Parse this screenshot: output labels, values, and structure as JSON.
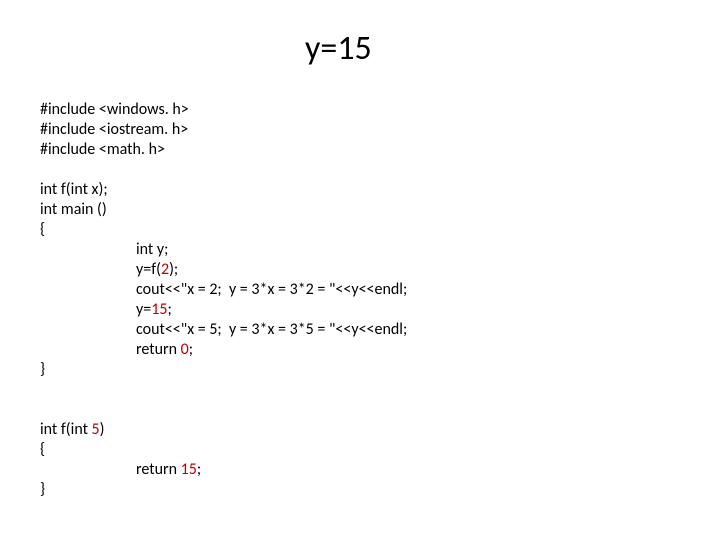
{
  "title": "y=15",
  "code": {
    "inc1": "#include <windows. h>",
    "inc2": "#include <iostream. h>",
    "inc3": "#include <math. h>",
    "proto": "int f(int x);",
    "main_sig": "int main ()",
    "open_brace": "{",
    "body_int_y": "int y;",
    "body_y_f": "y=f(",
    "body_y_f_arg": "2",
    "body_y_f_end": ");",
    "body_cout1": "cout<<\"x = 2;  y = 3*x = 3*2 = \"<<y<<endl;",
    "body_y15_pre": "y=",
    "body_y15_val": "15",
    "body_y15_post": ";",
    "body_cout2": "cout<<\"x = 5;  y = 3*x = 3*5 = \"<<y<<endl;",
    "body_return0_pre": "return ",
    "body_return0_val": "0",
    "body_return0_post": ";",
    "close_brace": "}",
    "f_sig_pre": "int f(int ",
    "f_sig_arg": "5",
    "f_sig_post": ")",
    "f_open": "{",
    "f_return_pre": "return ",
    "f_return_val": "15",
    "f_return_post": ";",
    "f_close": "}"
  }
}
